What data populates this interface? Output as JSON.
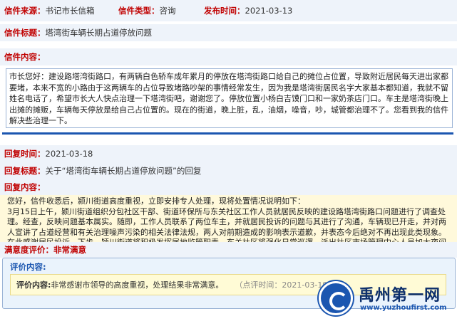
{
  "meta": {
    "source_label": "信件来源：",
    "source_value": "书记市长信箱",
    "type_label": "信件类型：",
    "type_value": "咨询",
    "date_label": "发布时间：",
    "date_value": "2021-03-13"
  },
  "letter": {
    "title_label": "信件标题：",
    "title_value": "塔湾街车辆长期占道停放问题",
    "content_label": "信件内容：",
    "content_value": "市长您好：建设路塔湾街路口，有两辆白色轿车成年累月的停放在塔湾街路口给自己的摊位占位置，导致附近居民每天进出家都要堵，本来不宽的小路由于这两辆车的占位导致堵路吵架的事情经常发生，因为我是塔湾街居民名字大家基本都知道，我就不留姓名电话了，希望市长大人快点治理一下塔湾街吧，谢谢您了。停放位置小杨白吉馍门口和一家奶茶店门口。车主是塔湾街晚上出摊的摊贩，车辆每天停放是给自己占位置的。现在的街道，晚上脏，乱，油烟，噪音，吵，城管都治理不了。您看到我的信件解决些治理一下。"
  },
  "reply": {
    "time_label": "回复时间：",
    "time_value": "2021-03-18",
    "title_label": "回复标题：",
    "title_value": "关于“塔湾街车辆长期占道停放问题”的回复",
    "content_label": "回复内容：",
    "content_value": "您好，信件收悉后，颍川街道高度重视，立即安排专人处理，现将处置情况说明如下：\n3月15日上午，颍川街道组织分包社区干部、街道环保所与东关社区工作人员就居民反映的建设路塔湾街路口问题进行了调查处理。经查，反映问题基本属实。随即，工作人员联系了两位车主，并就居民投诉的问题与其进行了沟通，车辆现已开走，并对两人宣讲了占道经营和有关治理噪声污染的相关法律法规，两人对前期造成的影响表示道歉，并表态今后绝对不再出现此类现象。在此感谢居民投诉。下步，颍川街道将积极发挥属地监管职责，东关社区将强化日常巡逻，派出社区市场管理中心人员加大夜间巡逻力度，杜绝此类问题再次发生。"
  },
  "satisfaction": {
    "label": "满意度评价：",
    "value": "非常满意"
  },
  "evaluation": {
    "header": "评价内容:",
    "content_label": "评价内容:",
    "content_value": "非常感谢市领导的高度重视，处理结果非常满意。",
    "time_text": "（点评时间：2021-03-19 1"
  },
  "watermark": {
    "name": "禹州第一网",
    "url": "www.yuzhoufirst.com"
  },
  "colors": {
    "label_red": "#c00000",
    "row_bg": "#eef3fa",
    "separator_blue": "#1b56b0",
    "reply_bg": "#fff9db"
  }
}
